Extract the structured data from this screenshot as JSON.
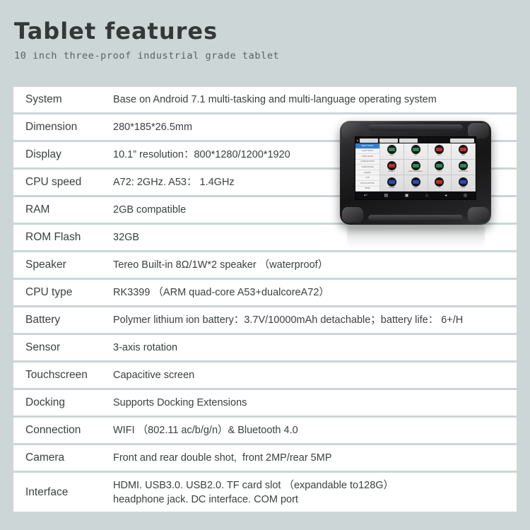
{
  "header": {
    "title": "Tablet features",
    "subtitle": "10 inch three-proof industrial grade tablet"
  },
  "colors": {
    "page_background": "#ccd6d6",
    "row_background": "#ffffff",
    "title_text": "#333838",
    "subtitle_text": "#5a6262",
    "body_text": "#3b4040"
  },
  "spec_table": {
    "rows": [
      {
        "label": "System",
        "value": "Base on Android 7.1 multi-tasking and multi-language operating system"
      },
      {
        "label": "Dimension",
        "value": "280*185*26.5mm"
      },
      {
        "label": "Display",
        "value": "10.1” resolution：800*1280/1200*1920"
      },
      {
        "label": "CPU speed",
        "value": "A72: 2GHz. A53： 1.4GHz"
      },
      {
        "label": "RAM",
        "value": "2GB compatible"
      },
      {
        "label": "ROM Flash",
        "value": "32GB"
      },
      {
        "label": "Speaker",
        "value": "Tereo Built-in 8Ω/1W*2 speaker （waterproof）"
      },
      {
        "label": "CPU type",
        "value": "RK3399 （ARM quad-core A53+dualcoreA72）"
      },
      {
        "label": "Battery",
        "value": "Polymer lithium ion battery：3.7V/10000mAh detachable；battery life： 6+/H"
      },
      {
        "label": "Sensor",
        "value": "3-axis rotation"
      },
      {
        "label": "Touchscreen",
        "value": "Capacitive screen"
      },
      {
        "label": "Docking",
        "value": "Supports Docking Extensions"
      },
      {
        "label": "Connection",
        "value": "WIFI （802.11 ac/b/g/n）& Bluetooth 4.0"
      },
      {
        "label": "Camera",
        "value": "Front and rear double shot,  front 2MP/rear 5MP"
      },
      {
        "label": "Interface",
        "value": "HDMI. USB3.0. USB2.0. TF card slot （expandable to128G）",
        "value_line2": "headphone jack. DC interface. COM port"
      }
    ]
  },
  "product_image": {
    "alt": "rugged industrial tablet showing vehicle diagnostic app",
    "screen": {
      "sidebar_items": [
        "HEAVY TRUCK",
        "LIGHT TRUCK",
        "CHINA TRUCK",
        "CONSTRUCTION",
        "AGRICULTURE",
        "ENGINE",
        "CAR",
        "BUS & LIGHTING",
        "MORE"
      ],
      "tabs": [
        "TRUCK",
        "DIESEL",
        "HISTORY"
      ],
      "apps": [
        {
          "label": "BENZ",
          "color": "#2e8b57"
        },
        {
          "label": "DAF",
          "color": "#2e8b57"
        },
        {
          "label": "IVECO",
          "color": "#c22c2c"
        },
        {
          "label": "MAN",
          "color": "#c22c2c"
        },
        {
          "label": "RENAULT",
          "color": "#c22c2c"
        },
        {
          "label": "MERCEDES-BENZ",
          "color": "#2e8b57"
        },
        {
          "label": "VOLVO",
          "color": "#2e8b57"
        },
        {
          "label": "MITSUBISHI",
          "color": "#2e8b57"
        },
        {
          "label": "SCANIA",
          "color": "#2f49b5"
        },
        {
          "label": "HINO",
          "color": "#2f49b5"
        },
        {
          "label": "UD",
          "color": "#c22c2c"
        },
        {
          "label": "ISUZU",
          "color": "#2f49b5"
        }
      ],
      "navbar_icons": [
        "back-icon",
        "menu-icon",
        "apps-icon",
        "home-icon",
        "volume-icon",
        "camera-icon"
      ]
    }
  }
}
